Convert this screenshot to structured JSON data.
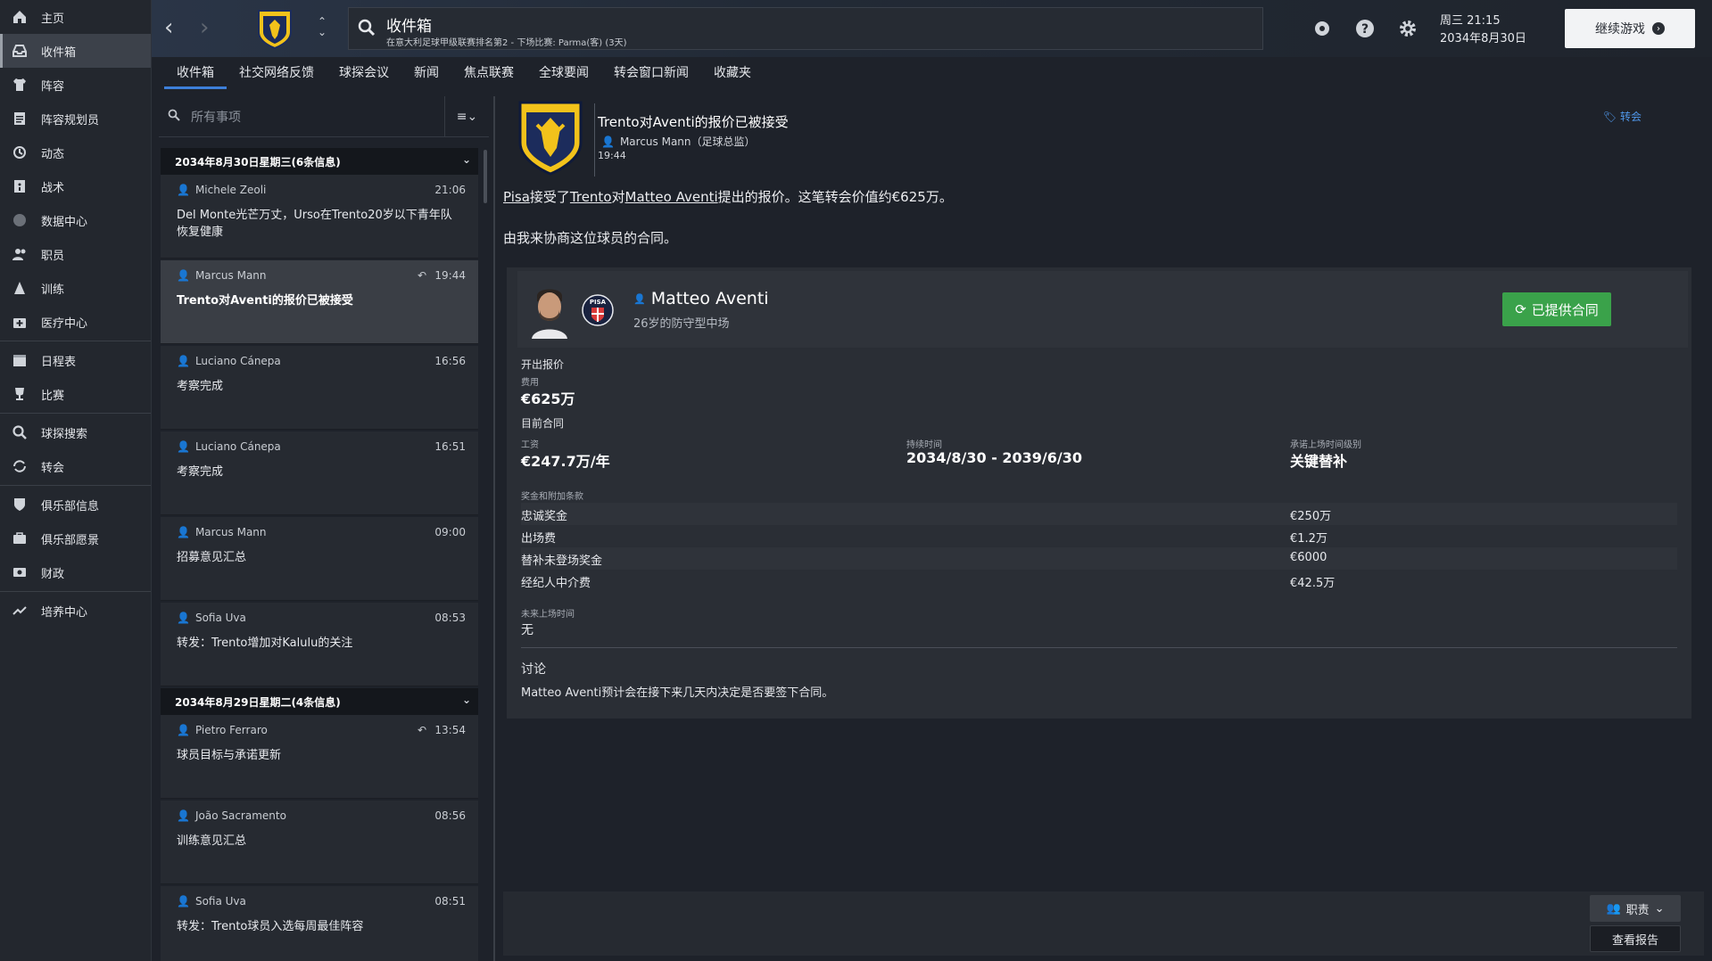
{
  "sidebar": {
    "items": [
      {
        "label": "主页",
        "icon": "home-icon"
      },
      {
        "label": "收件箱",
        "icon": "inbox-icon"
      },
      {
        "label": "阵容",
        "icon": "shirt-icon"
      },
      {
        "label": "阵容规划员",
        "icon": "clipboard-icon"
      },
      {
        "label": "动态",
        "icon": "dynamics-icon"
      },
      {
        "label": "战术",
        "icon": "tactics-icon"
      },
      {
        "label": "数据中心",
        "icon": "data-icon"
      },
      {
        "label": "职员",
        "icon": "staff-icon"
      },
      {
        "label": "训练",
        "icon": "training-icon"
      },
      {
        "label": "医疗中心",
        "icon": "medical-icon"
      },
      {
        "label": "日程表",
        "icon": "calendar-icon"
      },
      {
        "label": "比赛",
        "icon": "trophy-icon"
      },
      {
        "label": "球探搜索",
        "icon": "scouting-icon"
      },
      {
        "label": "转会",
        "icon": "transfer-icon"
      },
      {
        "label": "俱乐部信息",
        "icon": "shield-icon"
      },
      {
        "label": "俱乐部愿景",
        "icon": "vision-icon"
      },
      {
        "label": "财政",
        "icon": "finance-icon"
      },
      {
        "label": "培养中心",
        "icon": "development-icon"
      }
    ]
  },
  "header": {
    "title": "收件箱",
    "subtitle": "在意大利足球甲级联赛排名第2 - 下场比赛: Parma(客) (3天)",
    "day_time": "周三 21:15",
    "date": "2034年8月30日",
    "continue_label": "继续游戏"
  },
  "tabs": [
    {
      "label": "收件箱"
    },
    {
      "label": "社交网络反馈"
    },
    {
      "label": "球探会议"
    },
    {
      "label": "新闻"
    },
    {
      "label": "焦点联赛"
    },
    {
      "label": "全球要闻"
    },
    {
      "label": "转会窗口新闻"
    },
    {
      "label": "收藏夹"
    }
  ],
  "inbox": {
    "filter_placeholder": "所有事项",
    "day1_header": "2034年8月30日星期三(6条信息)",
    "day2_header": "2034年8月29日星期二(4条信息)",
    "messages": [
      {
        "sender": "Michele Zeoli",
        "time": "21:06",
        "subject": "Del Monte光芒万丈，Urso在Trento20岁以下青年队恢复健康"
      },
      {
        "sender": "Marcus Mann",
        "time": "19:44",
        "subject": "Trento对Aventi的报价已被接受"
      },
      {
        "sender": "Luciano Cánepa",
        "time": "16:56",
        "subject": "考察完成"
      },
      {
        "sender": "Luciano Cánepa",
        "time": "16:51",
        "subject": "考察完成"
      },
      {
        "sender": "Marcus Mann",
        "time": "09:00",
        "subject": "招募意见汇总"
      },
      {
        "sender": "Sofia Uva",
        "time": "08:53",
        "subject": "转发：Trento增加对Kalulu的关注"
      },
      {
        "sender": "Pietro Ferraro",
        "time": "13:54",
        "subject": "球员目标与承诺更新"
      },
      {
        "sender": "João Sacramento",
        "time": "08:56",
        "subject": "训练意见汇总"
      },
      {
        "sender": "Sofia Uva",
        "time": "08:51",
        "subject": "转发：Trento球员入选每周最佳阵容"
      }
    ]
  },
  "detail": {
    "title": "Trento对Aventi的报价已被接受",
    "from": "Marcus Mann（足球总监）",
    "time": "19:44",
    "tag": "转会",
    "para1_a": "Pisa",
    "para1_b": "接受了",
    "para1_c": "Trento",
    "para1_d": "对",
    "para1_e": "Matteo Aventi",
    "para1_f": "提出的报价。这笔转会价值约€625万。",
    "para2": "由我来协商这位球员的合同。",
    "player": {
      "name": "Matteo Aventi",
      "position": "26岁的防守型中场",
      "club_badge_text": "PISA",
      "offer_button": "已提供合同"
    },
    "offer_section": "开出报价",
    "fee_label": "费用",
    "fee_value": "€625万",
    "contract_section": "目前合同",
    "wage_label": "工资",
    "wage_value": "€247.7万/年",
    "duration_label": "持续时间",
    "duration_value": "2034/8/30 - 2039/6/30",
    "playing_time_label": "承诺上场时间级别",
    "playing_time_value": "关键替补",
    "bonus_section": "奖金和附加条款",
    "bonuses": [
      {
        "k": "忠诚奖金",
        "v": "€250万"
      },
      {
        "k": "出场费",
        "v": "€1.2万"
      },
      {
        "k": "替补未登场奖金",
        "v": "€6000"
      },
      {
        "k": "经纪人中介费",
        "v": "€42.5万"
      }
    ],
    "future_label": "未来上场时间",
    "future_value": "无",
    "discussion_label": "讨论",
    "discussion_text": "Matteo Aventi预计会在接下来几天内决定是否要签下合同。"
  },
  "footer": {
    "role_button": "职责",
    "report_button": "查看报告"
  },
  "colors": {
    "accent": "#3d7fd9",
    "offer_green": "#3aa24a",
    "crest_yellow": "#f2c21b",
    "crest_navy": "#1c2c5c"
  }
}
